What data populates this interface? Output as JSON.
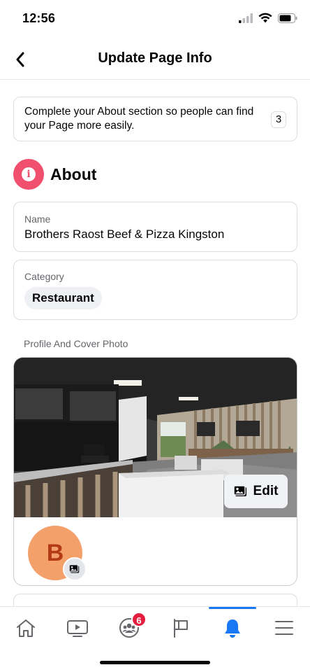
{
  "status_bar": {
    "time": "12:56"
  },
  "header": {
    "title": "Update Page Info"
  },
  "prompt": {
    "text": "Complete your About section so people can find your Page more easily.",
    "count": "3"
  },
  "about": {
    "title": "About"
  },
  "name_field": {
    "label": "Name",
    "value": "Brothers Raost Beef & Pizza Kingston"
  },
  "category_field": {
    "label": "Category",
    "value": "Restaurant"
  },
  "photos": {
    "label": "Profile And Cover Photo",
    "edit_label": "Edit",
    "avatar_letter": "B"
  },
  "tab_bar": {
    "tabs": [
      {
        "icon": "home-icon"
      },
      {
        "icon": "video-icon"
      },
      {
        "icon": "groups-icon",
        "badge": "6"
      },
      {
        "icon": "pages-flag-icon"
      },
      {
        "icon": "notifications-bell-icon",
        "active": true
      },
      {
        "icon": "menu-icon"
      }
    ]
  },
  "colors": {
    "accent": "#1877f2",
    "about_icon": "#f0506e",
    "badge": "#e41e3f",
    "avatar": "#f4a06a"
  }
}
